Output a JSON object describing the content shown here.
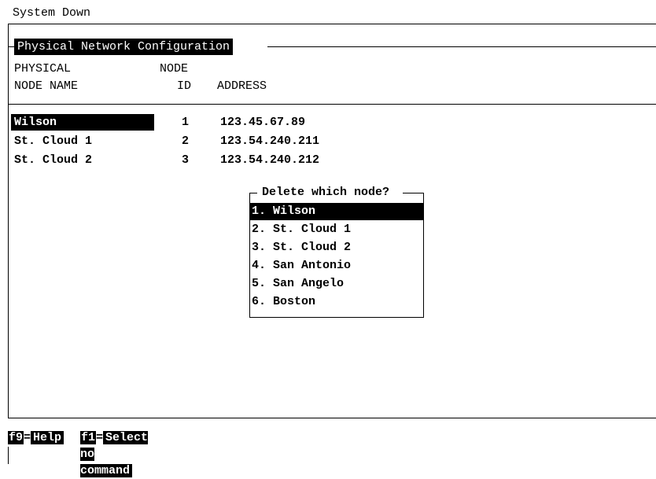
{
  "status_line": "System Down",
  "window": {
    "title": "Physical Network Configuration"
  },
  "table": {
    "header_row1": {
      "physical": "PHYSICAL",
      "node": "NODE"
    },
    "header_row2": {
      "node_name": "NODE NAME",
      "id": "ID",
      "address": "ADDRESS"
    },
    "rows": [
      {
        "name": "Wilson",
        "id": "1",
        "address": "123.45.67.89",
        "selected": true
      },
      {
        "name": "St. Cloud 1",
        "id": "2",
        "address": "123.54.240.211",
        "selected": false
      },
      {
        "name": "St. Cloud 2",
        "id": "3",
        "address": "123.54.240.212",
        "selected": false
      }
    ]
  },
  "popup": {
    "title": "Delete which node?",
    "items": [
      {
        "label": "1. Wilson",
        "selected": true
      },
      {
        "label": "2. St. Cloud 1",
        "selected": false
      },
      {
        "label": "3. St. Cloud 2",
        "selected": false
      },
      {
        "label": "4. San Antonio",
        "selected": false
      },
      {
        "label": "5. San Angelo",
        "selected": false
      },
      {
        "label": "6. Boston",
        "selected": false
      }
    ]
  },
  "function_keys": [
    {
      "key": "f9",
      "label": "Help"
    },
    {
      "key": "f1",
      "label": "Select no command"
    }
  ],
  "colors": {
    "foreground": "#000000",
    "background": "#ffffff",
    "highlight": "#000000"
  }
}
